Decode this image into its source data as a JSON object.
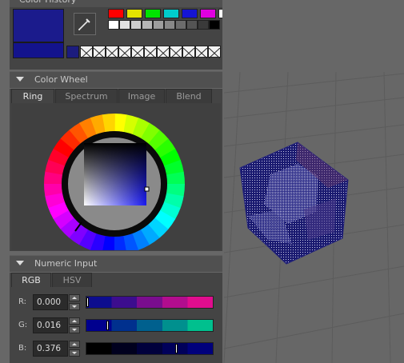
{
  "color_history": {
    "title": "Color History",
    "palette_top": [
      "#ff0000",
      "#e4e400",
      "#00e400",
      "#00cdcd",
      "#1515d4",
      "#e000e0",
      "#ffffff"
    ],
    "palette_gray": [
      "#ffffff",
      "#e2e2e2",
      "#cdcdcd",
      "#b6b6b6",
      "#9e9e9e",
      "#888888",
      "#6c6c6c",
      "#545454",
      "#3a3a3a",
      "#000000"
    ],
    "current_color": "#1b1b8c",
    "previous_color": "#13138d",
    "small_swatch": "#1c1c7e",
    "empty_slots": 11
  },
  "color_wheel": {
    "title": "Color Wheel",
    "tabs": [
      "Ring",
      "Spectrum",
      "Image",
      "Blend"
    ],
    "active_tab": "Ring"
  },
  "numeric_input": {
    "title": "Numeric Input",
    "tabs": [
      "RGB",
      "HSV"
    ],
    "active_tab": "RGB",
    "fields": [
      {
        "label": "R:",
        "value": "0.000",
        "level": 0.0,
        "gradient": [
          "#0d0d8e",
          "#3c0d8e",
          "#7a0d8e",
          "#b20d8e",
          "#e00d8e"
        ]
      },
      {
        "label": "G:",
        "value": "0.016",
        "level": 0.16,
        "gradient": [
          "#00008e",
          "#00308e",
          "#00608e",
          "#00908e",
          "#00c08e"
        ]
      },
      {
        "label": "B:",
        "value": "0.376",
        "level": 0.72,
        "gradient": [
          "#000000",
          "#00001e",
          "#00003c",
          "#00005a",
          "#00007c"
        ]
      }
    ]
  }
}
